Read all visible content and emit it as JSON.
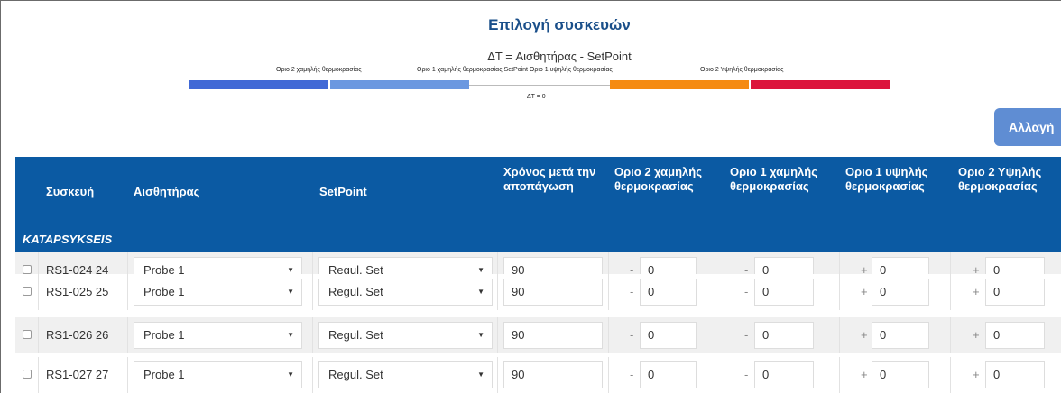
{
  "header": {
    "title": "Επιλογή συσκευών",
    "delta_label": "ΔT = Αισθητήρας - SetPoint",
    "scale_labels": {
      "low2": "Οριο 2 χαμηλής θερμοκρασίας",
      "low1_set_high1": "Οριο 1 χαμηλής θερμοκρασίας SetPoint Οριο 1 υψηλής θερμοκρασίας",
      "high2": "Οριο 2 Υψηλής θερμοκρασίας",
      "zero": "ΔT = 0"
    },
    "colors": {
      "low2": "#4169d6",
      "low1": "#6b98e0",
      "high1": "#f58b12",
      "high2": "#dc143c",
      "header_bg": "#0b5aa3"
    },
    "change_button": "Αλλαγή"
  },
  "table": {
    "columns": {
      "device": "Συσκευή",
      "sensor": "Αισθητήρας",
      "setpoint": "SetPoint",
      "time_after_defrost": "Χρόνος μετά την αποπάγωση",
      "low2": "Οριο 2 χαμηλής θερμοκρασίας",
      "low1": "Οριο 1 χαμηλής θερμοκρασίας",
      "high1": "Οριο 1 υψηλής θερμοκρασίας",
      "high2": "Οριο 2 Υψηλής θερμοκρασίας"
    },
    "group": "KATAPSYKSEIS",
    "rows": [
      {
        "device": "RS1-024 24",
        "sensor": "Probe 1",
        "setpoint": "Regul. Set",
        "time": "90",
        "low2_sign": "-",
        "low2": "0",
        "low1_sign": "-",
        "low1": "0",
        "high1_sign": "+",
        "high1": "0",
        "high2_sign": "+",
        "high2": "0"
      },
      {
        "device": "RS1-025 25",
        "sensor": "Probe 1",
        "setpoint": "Regul. Set",
        "time": "90",
        "low2_sign": "-",
        "low2": "0",
        "low1_sign": "-",
        "low1": "0",
        "high1_sign": "+",
        "high1": "0",
        "high2_sign": "+",
        "high2": "0"
      },
      {
        "device": "RS1-026 26",
        "sensor": "Probe 1",
        "setpoint": "Regul. Set",
        "time": "90",
        "low2_sign": "-",
        "low2": "0",
        "low1_sign": "-",
        "low1": "0",
        "high1_sign": "+",
        "high1": "0",
        "high2_sign": "+",
        "high2": "0"
      },
      {
        "device": "RS1-027 27",
        "sensor": "Probe 1",
        "setpoint": "Regul. Set",
        "time": "90",
        "low2_sign": "-",
        "low2": "0",
        "low1_sign": "-",
        "low1": "0",
        "high1_sign": "+",
        "high1": "0",
        "high2_sign": "+",
        "high2": "0"
      }
    ]
  }
}
